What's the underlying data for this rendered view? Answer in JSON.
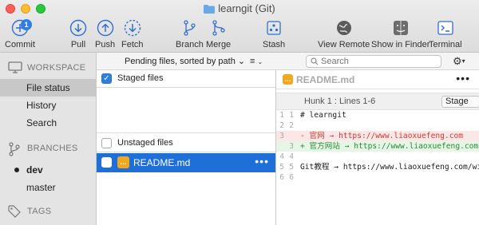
{
  "window": {
    "title": "learngit (Git)"
  },
  "toolbar": {
    "commit": {
      "label": "Commit",
      "badge": "1"
    },
    "pull": "Pull",
    "push": "Push",
    "fetch": "Fetch",
    "branch": "Branch",
    "merge": "Merge",
    "stash": "Stash",
    "view_remote": "View Remote",
    "show_in_finder": "Show in Finder",
    "terminal": "Terminal"
  },
  "sidebar": {
    "workspace": {
      "heading": "WORKSPACE",
      "items": [
        "File status",
        "History",
        "Search"
      ],
      "selected": "File status"
    },
    "branches": {
      "heading": "BRANCHES",
      "items": [
        "dev",
        "master"
      ],
      "current": "dev"
    },
    "tags": {
      "heading": "TAGS"
    }
  },
  "files": {
    "sort_label": "Pending files, sorted by path",
    "list_icon": "≡",
    "staged": {
      "label": "Staged files",
      "checked": true
    },
    "unstaged": {
      "label": "Unstaged files",
      "checked": false
    },
    "items": [
      {
        "name": "README.md",
        "more": "•••"
      }
    ]
  },
  "search": {
    "placeholder": "Search"
  },
  "diff": {
    "file": "README.md",
    "more": "•••",
    "hunk_label": "Hunk 1 : Lines 1-6",
    "stage_label": "Stage",
    "lines": [
      {
        "old": "1",
        "new": "1",
        "text": "# learngit",
        "type": "ctx"
      },
      {
        "old": "2",
        "new": "2",
        "text": "",
        "type": "ctx"
      },
      {
        "old": "3",
        "new": "",
        "text": "- 官网 → https://www.liaoxuefeng.com",
        "type": "del"
      },
      {
        "old": "",
        "new": "3",
        "text": "+ 官方网站 → https://www.liaoxuefeng.com",
        "type": "add"
      },
      {
        "old": "4",
        "new": "4",
        "text": "",
        "type": "ctx"
      },
      {
        "old": "5",
        "new": "5",
        "text": "Git教程 → https://www.liaoxuefeng.com/wiki",
        "type": "ctx"
      },
      {
        "old": "6",
        "new": "6",
        "text": "",
        "type": "ctx"
      }
    ]
  },
  "colors": {
    "accent": "#1f6fd8",
    "deleted": "#cc3b32",
    "added": "#2d8a36",
    "file_icon": "#f0a81e"
  }
}
